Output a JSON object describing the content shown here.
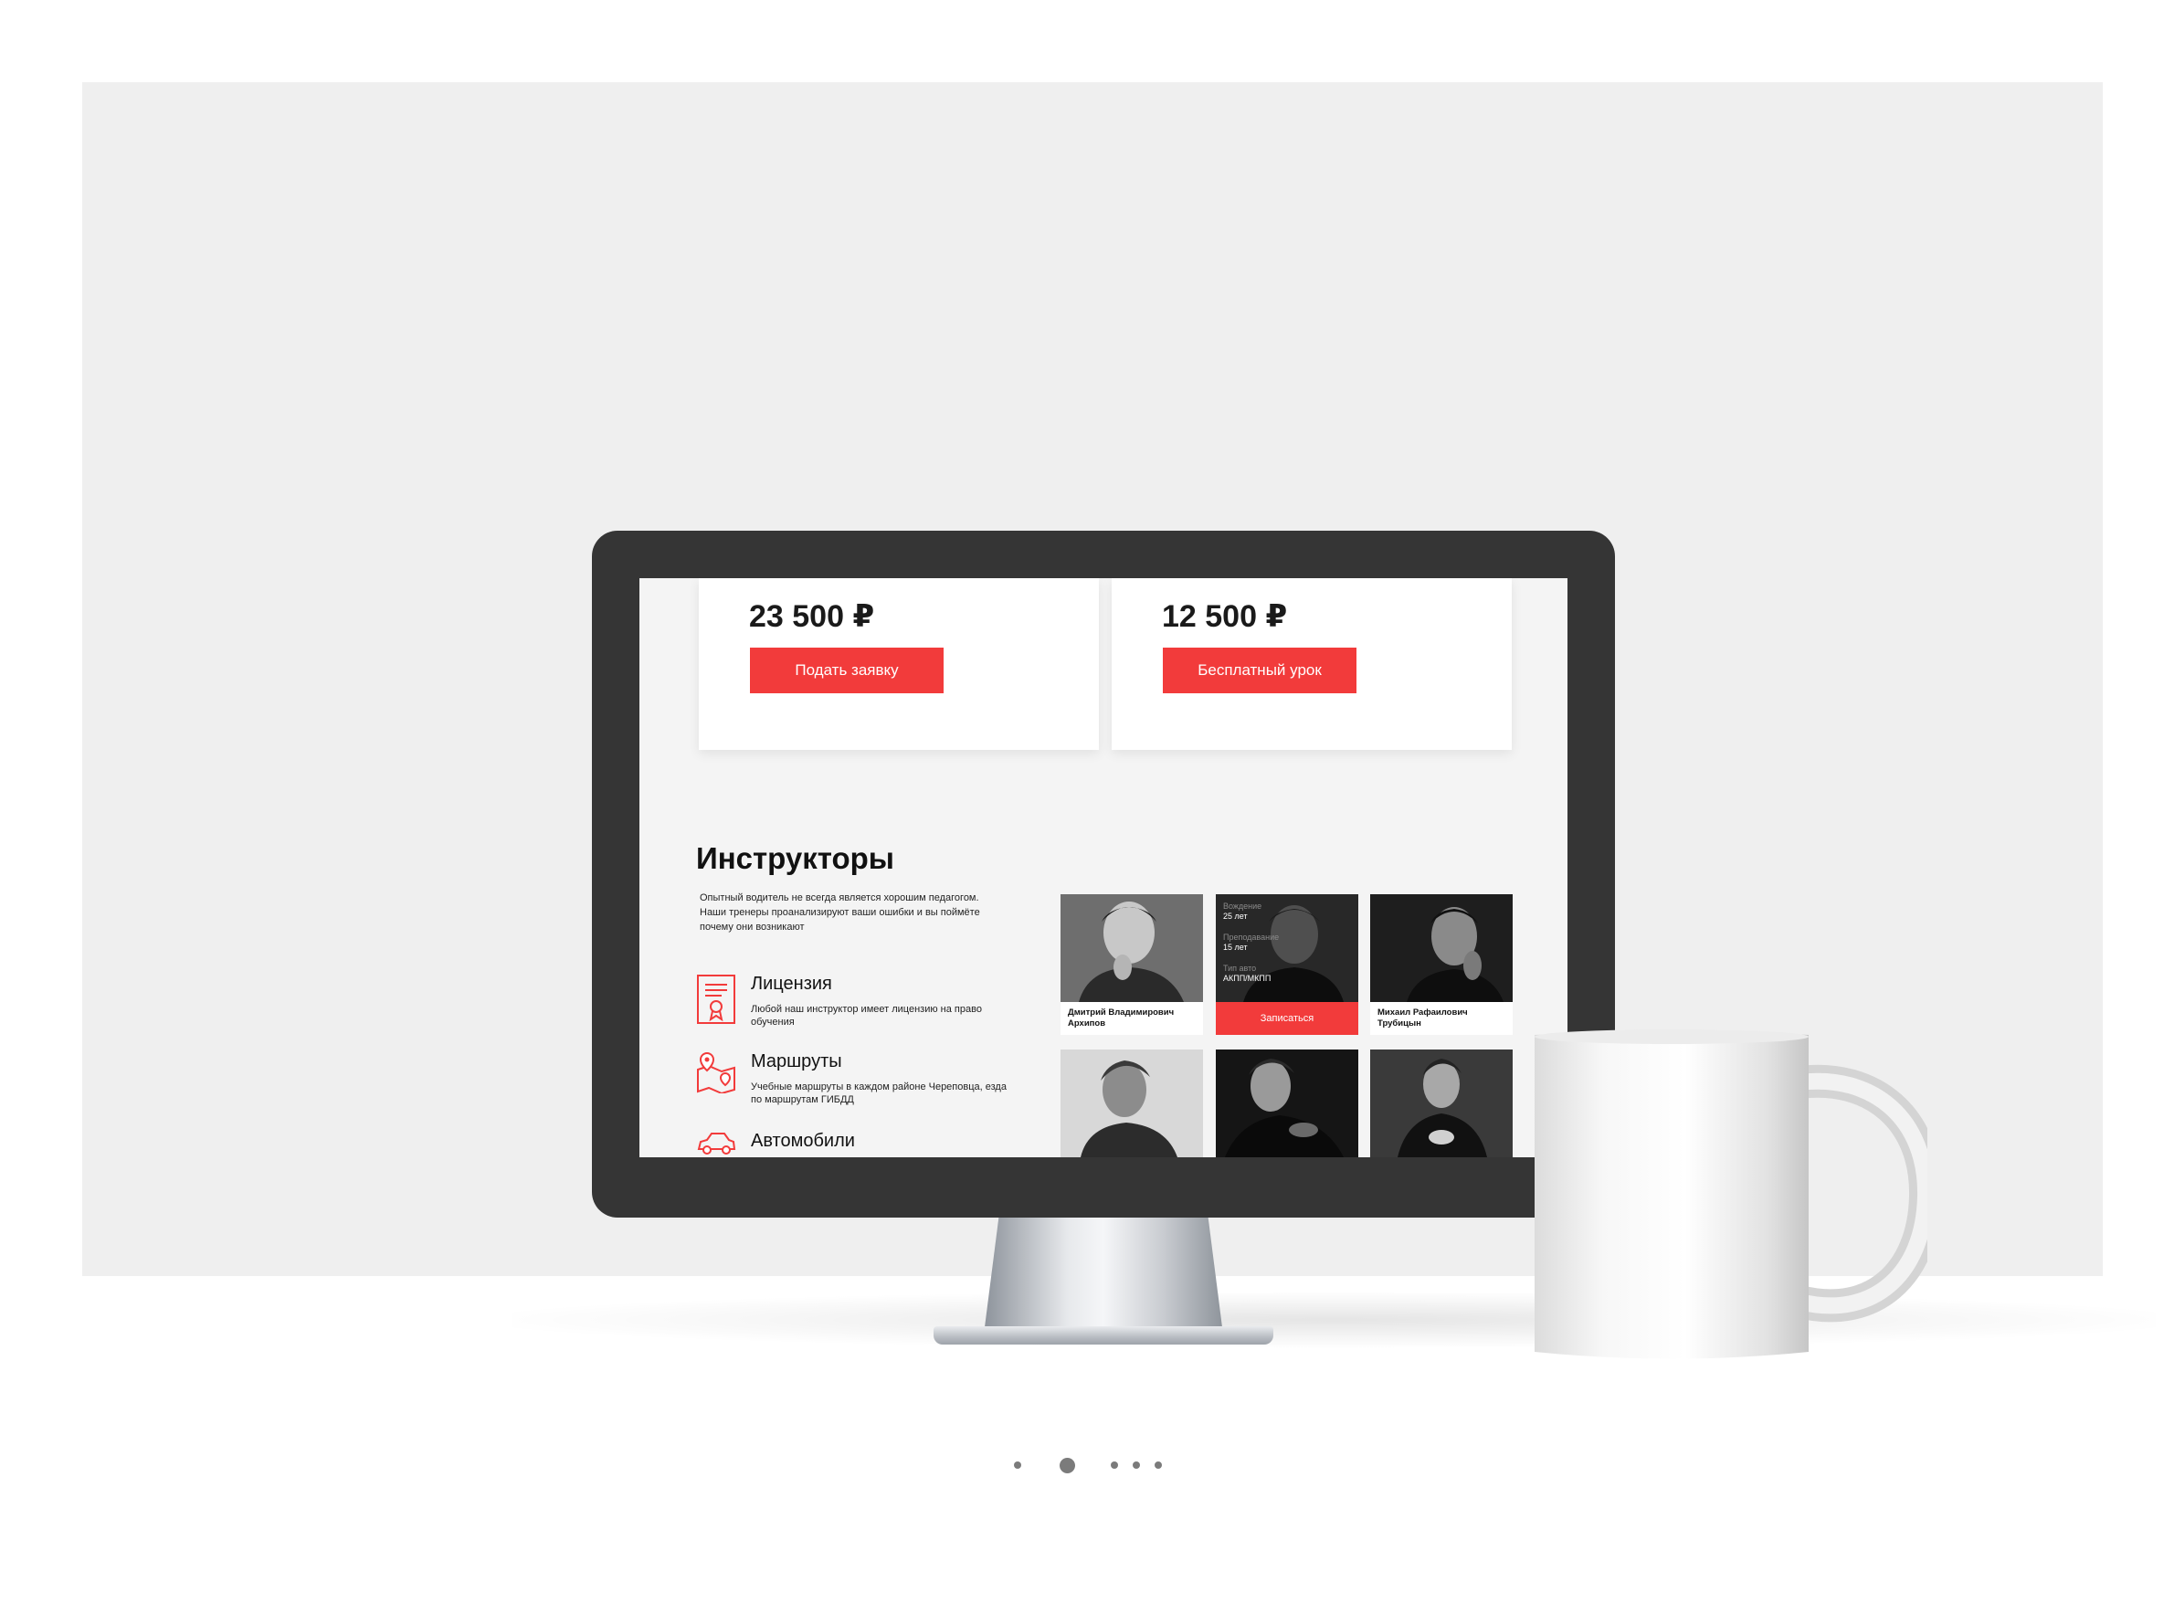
{
  "cards": [
    {
      "price": "23 500 ₽",
      "button_label": "Подать заявку"
    },
    {
      "price": "12 500 ₽",
      "button_label": "Бесплатный урок"
    }
  ],
  "instructors_section": {
    "title": "Инструкторы",
    "description": "Опытный водитель не всегда является хорошим педагогом. Наши тренеры проанализируют ваши ошибки и вы поймёте почему они возникают"
  },
  "features": [
    {
      "icon": "certificate-icon",
      "title": "Лицензия",
      "text": "Любой наш инструктор имеет лицензию на право обучения"
    },
    {
      "icon": "route-map-icon",
      "title": "Маршруты",
      "text": "Учебные маршруты в каждом районе Череповца, езда по маршрутам ГИБДД"
    },
    {
      "icon": "car-icon",
      "title": "Автомобили",
      "text": ""
    }
  ],
  "instructors": [
    {
      "name": "Дмитрий Владимирович Архипов"
    },
    {
      "name": "",
      "details": [
        {
          "label": "Вождение",
          "value": "25 лет"
        },
        {
          "label": "Преподавание",
          "value": "15 лет"
        },
        {
          "label": "Тип авто",
          "value": "АКПП/МКПП"
        }
      ],
      "button_label": "Записаться"
    },
    {
      "name": "Михаил Рафаилович Трубицын"
    },
    {
      "name": ""
    },
    {
      "name": ""
    },
    {
      "name": ""
    }
  ],
  "pagination": {
    "count": 5,
    "active_index": 1
  },
  "colors": {
    "accent": "#f23b3b",
    "bezel": "#353535",
    "backdrop": "#efefef"
  }
}
